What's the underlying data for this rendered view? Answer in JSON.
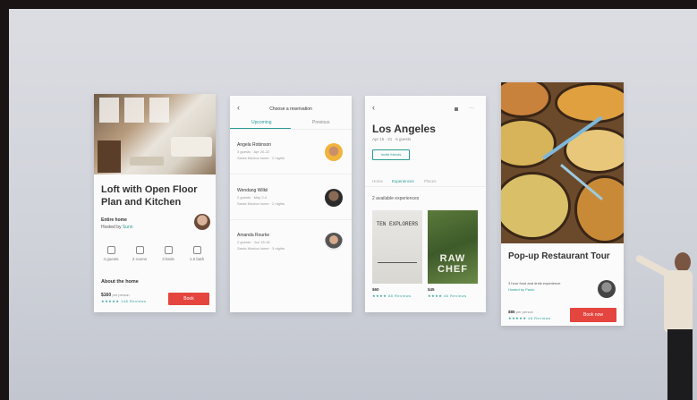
{
  "card_home": {
    "title": "Loft with Open Floor Plan and Kitchen",
    "type": "Entire home",
    "host": "Hosted by",
    "host_name": "Sunn",
    "amenities": [
      "4 guests",
      "2 rooms",
      "3 beds",
      "1.5 bath"
    ],
    "about": "About the home",
    "price": "$160",
    "price_unit": "per person",
    "reviews": "★★★★★ 148 Reviews",
    "book_label": "Book"
  },
  "card_reservation": {
    "back": "‹",
    "title": "Choose a reservation",
    "tabs": [
      "Upcoming",
      "Previous"
    ],
    "rows": [
      {
        "name": "Angela Robinson",
        "sub": "3 guests · Apr 20-22",
        "sub2": "Santa Monica home · 2 nights"
      },
      {
        "name": "Wendang Wilkii",
        "sub": "2 guests · May 2-4",
        "sub2": "Santa Monica home · 2 nights"
      },
      {
        "name": "Amanda Rourke",
        "sub": "2 guests · Jun 15-18",
        "sub2": "Santa Monica home · 3 nights"
      }
    ]
  },
  "card_city": {
    "back": "‹",
    "title": "Los Angeles",
    "dates": "Apr 15 - 21 · 6 guests",
    "invite_label": "Invite friends",
    "tabs": [
      "Home",
      "Experiences",
      "Places"
    ],
    "section": "2 available experiences",
    "items": [
      {
        "cover": "TEN EXPLORERS",
        "price": "$60",
        "reviews": "★★★★ 88 Reviews"
      },
      {
        "cover": "RAW CHEF",
        "price": "$45",
        "reviews": "★★★★ 46 Reviews"
      }
    ]
  },
  "card_tour": {
    "title": "Pop-up Restaurant Tour",
    "desc": "3 hour food and drink experience",
    "host": "Hosted by Paolo",
    "price": "$85",
    "price_unit": "per person",
    "reviews": "★★★★★ 48 Reviews",
    "book_label": "Book now"
  }
}
